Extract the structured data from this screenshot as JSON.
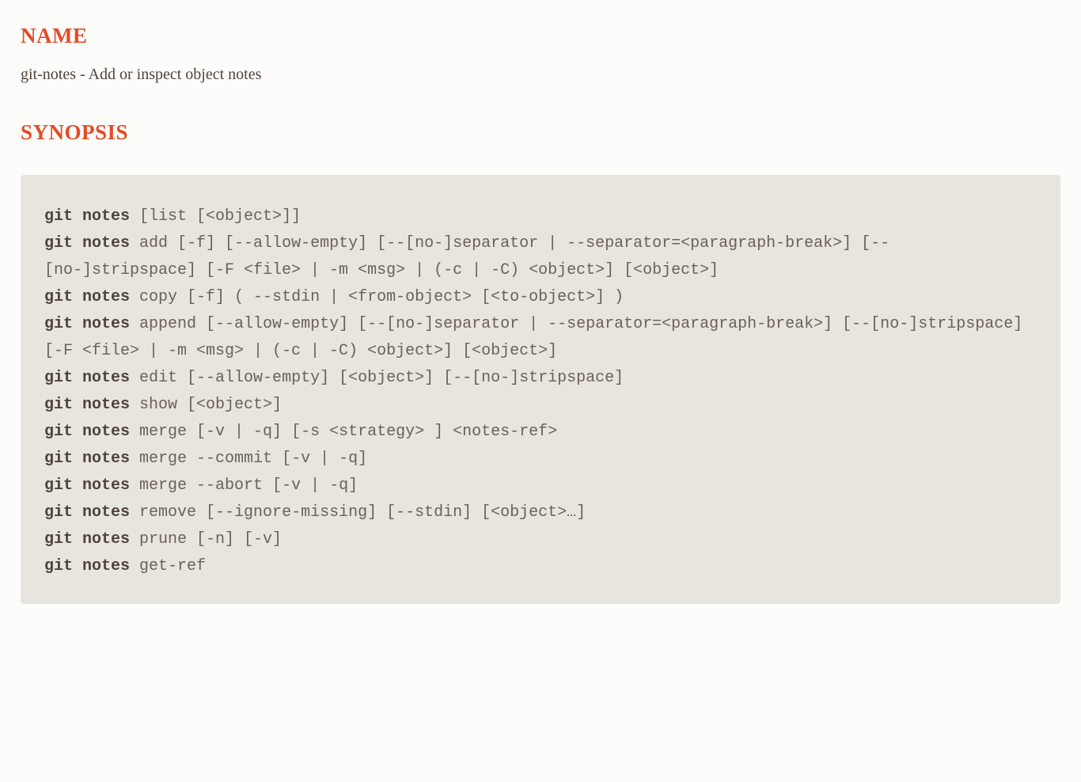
{
  "headings": {
    "name": "NAME",
    "synopsis": "SYNOPSIS"
  },
  "name_line": "git-notes - Add or inspect object notes",
  "synopsis": {
    "cmd": "git notes",
    "lines": [
      {
        "rest": " [list [<object>]]"
      },
      {
        "rest": " add [-f] [--allow-empty] [--[no-]separator | --separator=<paragraph-break>] [--[no-]stripspace] [-F <file> | -m <msg> | (-c | -C) <object>] [<object>]"
      },
      {
        "rest": " copy [-f] ( --stdin | <from-object> [<to-object>] )"
      },
      {
        "rest": " append [--allow-empty] [--[no-]separator | --separator=<paragraph-break>] [--[no-]stripspace] [-F <file> | -m <msg> | (-c | -C) <object>] [<object>]"
      },
      {
        "rest": " edit [--allow-empty] [<object>] [--[no-]stripspace]"
      },
      {
        "rest": " show [<object>]"
      },
      {
        "rest": " merge [-v | -q] [-s <strategy> ] <notes-ref>"
      },
      {
        "rest": " merge --commit [-v | -q]"
      },
      {
        "rest": " merge --abort [-v | -q]"
      },
      {
        "rest": " remove [--ignore-missing] [--stdin] [<object>…]"
      },
      {
        "rest": " prune [-n] [-v]"
      },
      {
        "rest": " get-ref"
      }
    ]
  }
}
